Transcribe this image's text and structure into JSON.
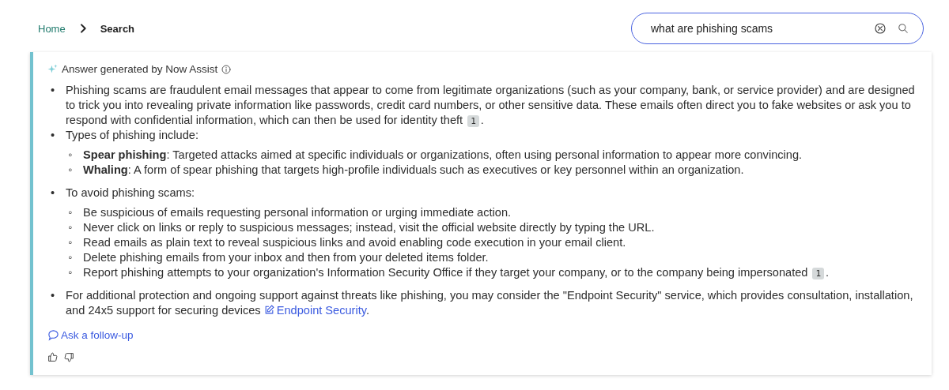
{
  "breadcrumb": [
    {
      "label": "Home",
      "kind": "link"
    },
    {
      "label": "Search",
      "kind": "current"
    }
  ],
  "search": {
    "value": "what are phishing scams"
  },
  "answer": {
    "header": "Answer generated by Now Assist",
    "items": [
      {
        "marker": "•",
        "text": "Phishing scams are fraudulent email messages that appear to come from legitimate organizations (such as your company, bank, or service provider) and are designed to trick you into revealing private information like passwords, credit card numbers, or other sensitive data. These emails often direct you to fake websites or ask you to respond with confidential information, which can then be used for identity theft",
        "citation": "1",
        "end": "."
      },
      {
        "marker": "•",
        "text": "Types of phishing include:",
        "children": [
          {
            "marker": "◦",
            "text": "**Spear phishing**: Targeted attacks aimed at specific individuals or organizations, often using personal information to appear more convincing."
          },
          {
            "marker": "◦",
            "text": "**Whaling**: A form of spear phishing that targets high-profile individuals such as executives or key personnel within an organization."
          }
        ]
      },
      {
        "marker": "•",
        "text": "To avoid phishing scams:",
        "children": [
          {
            "marker": "◦",
            "text": "Be suspicious of emails requesting personal information or urging immediate action."
          },
          {
            "marker": "◦",
            "text": "Never click on links or reply to suspicious messages; instead, visit the official website directly by typing the URL."
          },
          {
            "marker": "◦",
            "text": "Read emails as plain text to reveal suspicious links and avoid enabling code execution in your email client."
          },
          {
            "marker": "◦",
            "text": "Delete phishing emails from your inbox and then from your deleted items folder."
          },
          {
            "marker": "◦",
            "text": "Report phishing attempts to your organization's Information Security Office if they target your company, or to the company being impersonated",
            "citation": "1",
            "end": "."
          }
        ]
      },
      {
        "marker": "•",
        "text": "For additional protection and ongoing support against threats like phishing, you may consider the \"Endpoint Security\" service, which provides consultation, installation, and 24x5 support for securing devices",
        "link": "Endpoint Security",
        "end": "."
      }
    ],
    "follow_up": "Ask a follow-up"
  }
}
